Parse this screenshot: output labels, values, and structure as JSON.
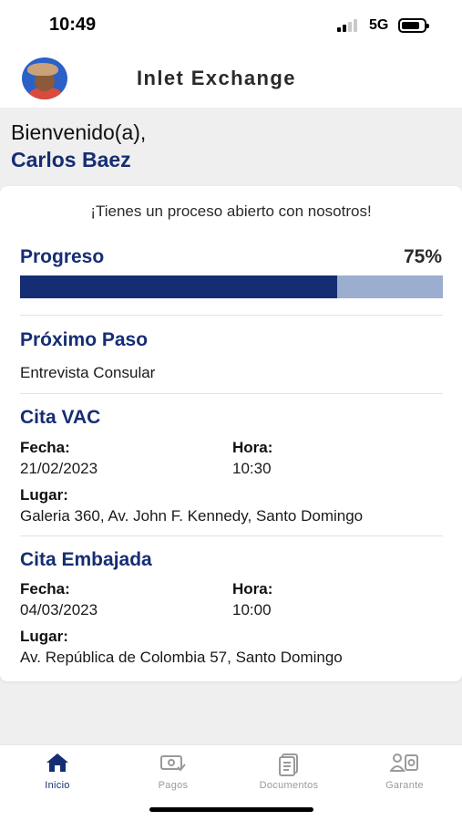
{
  "status_bar": {
    "time": "10:49",
    "network": "5G"
  },
  "header": {
    "title": "Inlet Exchange"
  },
  "welcome": {
    "greeting": "Bienvenido(a),",
    "user_name": "Carlos Baez"
  },
  "card": {
    "intro": "¡Tienes un proceso abierto con nosotros!",
    "progress": {
      "title": "Progreso",
      "value_label": "75%",
      "value": 0.75
    },
    "next_step": {
      "title": "Próximo Paso",
      "text": "Entrevista Consular"
    },
    "vac": {
      "title": "Cita VAC",
      "date_label": "Fecha:",
      "date": "21/02/2023",
      "time_label": "Hora:",
      "time": "10:30",
      "place_label": "Lugar:",
      "place": "Galeria 360, Av. John F. Kennedy, Santo Domingo"
    },
    "embassy": {
      "title": "Cita Embajada",
      "date_label": "Fecha:",
      "date": "04/03/2023",
      "time_label": "Hora:",
      "time": "10:00",
      "place_label": "Lugar:",
      "place": "Av. República de Colombia 57, Santo Domingo"
    }
  },
  "tabs": [
    {
      "label": "Inicio",
      "icon": "home-icon",
      "active": true
    },
    {
      "label": "Pagos",
      "icon": "payment-icon",
      "active": false
    },
    {
      "label": "Documentos",
      "icon": "documents-icon",
      "active": false
    },
    {
      "label": "Garante",
      "icon": "guarantor-icon",
      "active": false
    }
  ],
  "colors": {
    "primary": "#152e73",
    "progress_track": "#9caecf",
    "inactive_tab": "#9a9a9a"
  }
}
